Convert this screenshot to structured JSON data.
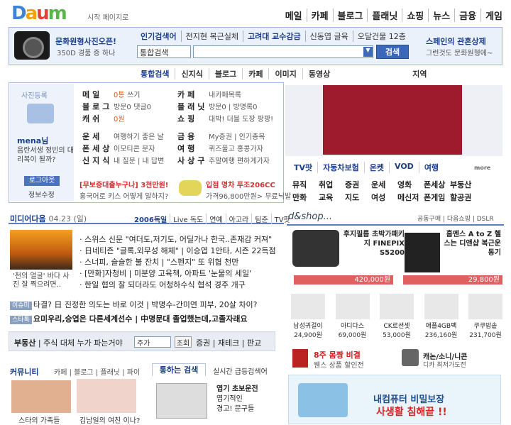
{
  "header": {
    "logo": "Daum",
    "start_page": "시작 페이지로",
    "gnb": [
      "메일",
      "카페",
      "블로그",
      "플래닛",
      "쇼핑",
      "뉴스",
      "금융",
      "게임"
    ]
  },
  "topbar": {
    "promo_title": "문화원형사진오픈!",
    "promo_sub": "350D 경품 증 하나",
    "keywords": [
      "인기검색어",
      "전지현 복근실체",
      "고려대 교수감금",
      "신동엽 글육",
      "오달건물 12층"
    ],
    "search_select": "통합검색",
    "search_value": "",
    "search_button": "검색",
    "right_title": "스페인의 관혼상제",
    "right_sub": "그런것도 문화원형에~"
  },
  "tabs": [
    "통합검색",
    "신지식",
    "블로그",
    "카페",
    "이미지",
    "동영상",
    "지역"
  ],
  "login": {
    "photo_label": "사진등록",
    "user": "mena님",
    "question": "음란서생 정빈의 대리복이 될까?",
    "logout": "로그아웃",
    "profile": "정보수정"
  },
  "services_left": [
    {
      "name": "메일",
      "count": "0통",
      "extra": "쓰기"
    },
    {
      "name": "블로그",
      "count": "방문0",
      "extra": "댓글0"
    },
    {
      "name": "캐쉬",
      "count": "0원",
      "extra": ""
    },
    {
      "name": "운세",
      "count": "",
      "extra": "여행하기 좋은 날"
    },
    {
      "name": "폰세상",
      "count": "",
      "extra": "이모티콘 문자"
    },
    {
      "name": "신지식",
      "count": "",
      "extra": "내 질문 | 내 답변"
    }
  ],
  "services_right": [
    {
      "name": "카페",
      "extra": "내카페목록"
    },
    {
      "name": "플래닛",
      "extra": "방문0 | 방명록0"
    },
    {
      "name": "쇼핑",
      "extra": "대박! 더블 도장 팡팡!"
    },
    {
      "name": "금융",
      "extra": "My증권 | 인기종목"
    },
    {
      "name": "여행",
      "extra": "퀴즈풀고 홍콩가자"
    },
    {
      "name": "사상구",
      "extra": "주말여행 편하게가자"
    }
  ],
  "promo_bottom": {
    "line1": "[무보증대출누구나] 3천만원!",
    "line2": "홍국어로 키스 어떻게 말하지?",
    "car1": "입점 명차 푸조206CC",
    "car2": "가격96,800만원> 무료닉발"
  },
  "service_bar": [
    "TV팟",
    "자동차보험",
    "온켓",
    "VOD",
    "여행"
  ],
  "more": "more",
  "service_grid": [
    "뮤직",
    "취업",
    "증권",
    "운세",
    "영화",
    "폰세상",
    "부동산",
    "",
    "만화",
    "교육",
    "지도",
    "여성",
    "메신저",
    "폰게임",
    "할공권",
    ""
  ],
  "media": {
    "title": "미디어다음",
    "date": "04.23 (일)",
    "tabs": [
      "2006독일",
      "Live 독도",
      "연예",
      "아고라",
      "팀준",
      "TV팟"
    ]
  },
  "headline_img_caption": "'천의 얼굴' 바다 사진 잘 찍으려면..",
  "news": [
    "스위스 신문 \"여더도,저기도, 어딜가나 한국..존재감 커져\"",
    "日네티즌 \"글록,외무성 해체\" | 이승엽 1안타, 시즌 22득점",
    "스너피, 슬슬한 불 잔치 | \"스펜지\" 또 위협 천만",
    "[만화]자청비 | 미분양 고육책, 아파트 '눈물의 세일'",
    "한일 협의 잘 되더라도 어청하수식 협석 경주 개구"
  ],
  "issues": [
    {
      "tag": "이슈미",
      "text": "타결? 日 진정한 의도는 바로 이것 | 박명수-간미연 피부, 20살 차이?"
    },
    {
      "tag": "스타톡",
      "text": "요미우리,승엽은 다른세계선수 | 中명문대 졸업했는데,고졸자래요"
    }
  ],
  "stock": {
    "label": "부동산",
    "query": "주식 대체 누가 파는거야",
    "input": "주가",
    "button": "조회",
    "links": "증권 | 재테크 | 판교"
  },
  "community": {
    "title": "커뮤니티",
    "tabs": "카페 | 블로그 | 플래닛 | 파이",
    "cap1": "스타의 가족들",
    "cap2": "김남일의 여친 이나?"
  },
  "trend": {
    "tab": "통하는 검색",
    "tab2": "실시간 급등검색어",
    "lines": [
      "엽기 초보운전",
      "엽기적인",
      "경고! 문구들"
    ]
  },
  "shop": {
    "logo": "d&shop...",
    "links": "공동구매 | 다음쇼핑 | DSLR",
    "p1": "후지필름 초박가패키지 FINEPIX S5200",
    "p1_price": "420,000원",
    "p2": "홈멘스 A to Z 헬스는 디앤샵 복근운동기",
    "p2_price": "29,800원",
    "thumbs": [
      {
        "name": "남성귀걸이",
        "price": "24,900원"
      },
      {
        "name": "아디다스",
        "price": "69,000원"
      },
      {
        "name": "CK로션셋",
        "price": "53,000원"
      },
      {
        "name": "애플4GB팩",
        "price": "236,160원"
      },
      {
        "name": "쿠쿠밥솥",
        "price": "231,700원"
      }
    ],
    "ad1": "8주 몸짱 비결",
    "ad1_sub": "웬스 상품 할인전",
    "ad2": "캐논/소니/니콘",
    "ad2_sub": "디카 최저가도전"
  },
  "bigad": {
    "line1": "내컴퓨터 비밀보장",
    "line2": "사생활 침해끝 !!"
  }
}
